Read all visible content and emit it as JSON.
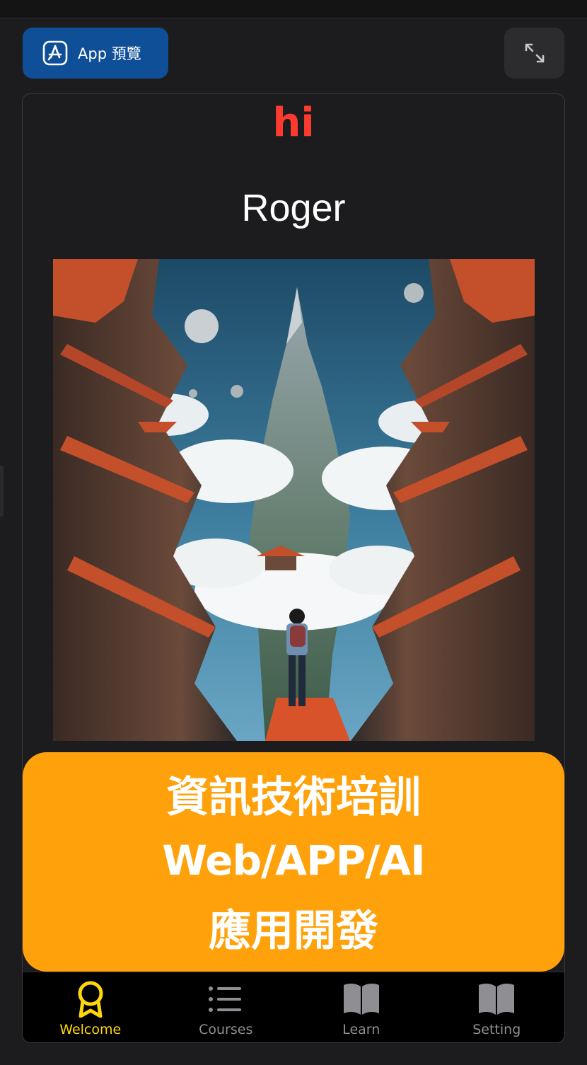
{
  "toolbar": {
    "app_preview_label": "App 預覽",
    "app_preview_icon": "app-store-icon",
    "expand_icon": "expand-arrows-icon"
  },
  "screen": {
    "greeting": "hi",
    "user_name": "Roger",
    "artwork_alt": "",
    "banner": {
      "line1": "資訊技術培訓",
      "line2": "Web/APP/AI",
      "line3": "應用開發"
    }
  },
  "tabbar": {
    "items": [
      {
        "label": "Welcome",
        "icon": "award-ribbon-icon",
        "active": true
      },
      {
        "label": "Courses",
        "icon": "list-icon",
        "active": false
      },
      {
        "label": "Learn",
        "icon": "open-book-icon",
        "active": false
      },
      {
        "label": "Setting",
        "icon": "open-book-icon",
        "active": false
      }
    ]
  },
  "colors": {
    "greeting": "#ff3b30",
    "banner_bg": "#ffa10a",
    "active_tab": "#ffd60a",
    "inactive_tab": "#8e8e93",
    "preview_btn": "#0f4f98"
  }
}
